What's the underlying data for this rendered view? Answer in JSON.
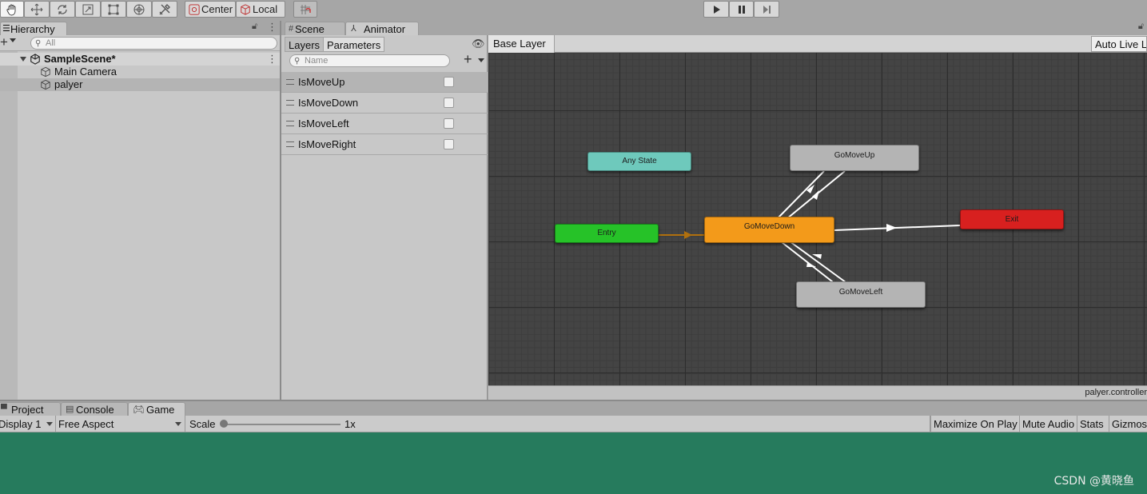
{
  "toolbar": {
    "tools": [
      "hand-tool",
      "move-tool",
      "rotate-tool",
      "scale-tool",
      "rect-tool",
      "transform-tool",
      "custom-tool"
    ],
    "pivot_mode": "Center",
    "pivot_rotation": "Local"
  },
  "hierarchy": {
    "tab_label": "Hierarchy",
    "search_placeholder": "All",
    "scene_name": "SampleScene*",
    "objects": [
      "Main Camera",
      "palyer"
    ]
  },
  "center_tabs": {
    "scene_label": "Scene",
    "animator_label": "Animator"
  },
  "animator": {
    "subtabs": {
      "layers": "Layers",
      "parameters": "Parameters"
    },
    "search_placeholder": "Name",
    "parameters": [
      {
        "name": "IsMoveUp",
        "value": false
      },
      {
        "name": "IsMoveDown",
        "value": false
      },
      {
        "name": "IsMoveLeft",
        "value": false
      },
      {
        "name": "IsMoveRight",
        "value": false
      }
    ],
    "breadcrumb": "Base Layer",
    "auto_live_link": "Auto Live Link",
    "controller_name": "palyer.controller",
    "states": {
      "any_state": "Any State",
      "entry": "Entry",
      "go_move_down": "GoMoveDown",
      "go_move_up": "GoMoveUp",
      "go_move_left": "GoMoveLeft",
      "exit": "Exit"
    },
    "colors": {
      "any_state": "#6ec9bc",
      "entry": "#26c228",
      "default_state": "#f39a1a",
      "state": "#b4b4b4",
      "exit": "#d8201f"
    }
  },
  "bottom_tabs": {
    "project": "Project",
    "console": "Console",
    "game": "Game"
  },
  "game": {
    "display": "Display 1",
    "aspect": "Free Aspect",
    "scale_label": "Scale",
    "scale_value": "1x",
    "maximize": "Maximize On Play",
    "mute": "Mute Audio",
    "stats": "Stats",
    "gizmos": "Gizmos",
    "background": "#267b5d"
  },
  "watermark": "CSDN @黄晓鱼"
}
